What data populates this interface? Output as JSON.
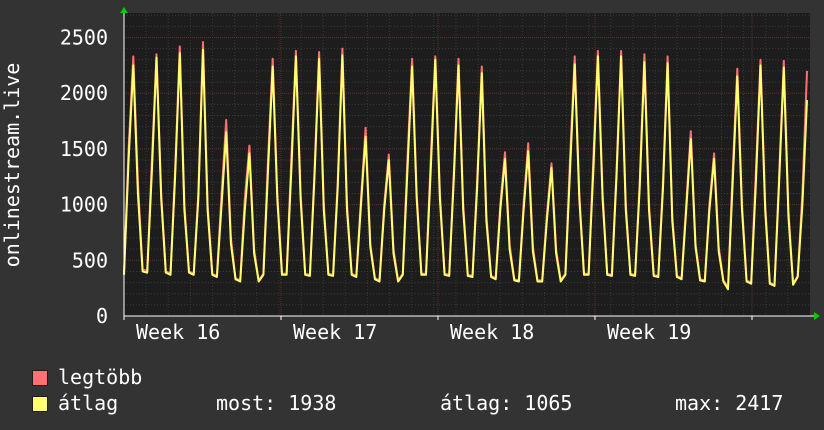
{
  "chart_data": {
    "type": "line",
    "ylabel": "onlinestream.live",
    "y_ticks": [
      0,
      500,
      1000,
      1500,
      2000,
      2500
    ],
    "ylim": [
      0,
      2500
    ],
    "x_ticks": [
      "Week 16",
      "Week 17",
      "Week 18",
      "Week 19"
    ],
    "grid": true,
    "series": [
      {
        "name": "legtöbb",
        "color": "#ff7070",
        "daily_peaks": [
          2330,
          2350,
          2420,
          2460,
          1760,
          1530,
          2310,
          2380,
          2370,
          2400,
          1690,
          1450,
          2310,
          2330,
          2310,
          2240,
          1470,
          1550,
          1370,
          2330,
          2380,
          2380,
          2350,
          2330,
          1660,
          1460,
          2220,
          2300,
          2290,
          2200
        ],
        "values": [
          380,
          1500,
          2330,
          1200,
          420,
          400,
          1400,
          2350,
          1100,
          400,
          380,
          1300,
          2420,
          1000,
          400,
          380,
          1100,
          2460,
          1000,
          380,
          360,
          1100,
          1760,
          700,
          340,
          320,
          1050,
          1530,
          600,
          320,
          380,
          1400,
          2310,
          1100,
          380,
          380,
          1400,
          2380,
          1100,
          380,
          370,
          1300,
          2370,
          1000,
          380,
          370,
          1200,
          2400,
          1000,
          380,
          360,
          1050,
          1690,
          650,
          340,
          320,
          1000,
          1450,
          600,
          320,
          380,
          1400,
          2310,
          1100,
          380,
          380,
          1400,
          2330,
          1100,
          380,
          370,
          1300,
          2310,
          1000,
          370,
          360,
          1200,
          2240,
          900,
          360,
          340,
          1000,
          1470,
          640,
          330,
          320,
          1000,
          1550,
          620,
          320,
          320,
          900,
          1370,
          600,
          320,
          380,
          1400,
          2330,
          1100,
          380,
          380,
          1400,
          2380,
          1100,
          380,
          370,
          1300,
          2380,
          1000,
          380,
          370,
          1200,
          2350,
          1000,
          370,
          360,
          1200,
          2330,
          900,
          360,
          340,
          1000,
          1660,
          650,
          330,
          320,
          1000,
          1460,
          620,
          320,
          260,
          1300,
          2220,
          1000,
          320,
          300,
          1300,
          2300,
          1000,
          300,
          280,
          1250,
          2290,
          950,
          290,
          360,
          1100,
          2200
        ]
      },
      {
        "name": "átlag",
        "color": "#ffff70",
        "daily_peaks": [
          2250,
          2320,
          2360,
          2390,
          1650,
          1460,
          2240,
          2330,
          2310,
          2340,
          1610,
          1400,
          2240,
          2300,
          2250,
          2180,
          1410,
          1480,
          1330,
          2260,
          2330,
          2330,
          2280,
          2270,
          1590,
          1410,
          2150,
          2250,
          2230,
          1938
        ],
        "values": [
          370,
          1400,
          2250,
          1100,
          400,
          390,
          1300,
          2320,
          1050,
          390,
          370,
          1250,
          2360,
          950,
          390,
          370,
          1050,
          2390,
          950,
          370,
          350,
          1000,
          1650,
          650,
          330,
          310,
          950,
          1460,
          560,
          310,
          370,
          1300,
          2240,
          1050,
          370,
          370,
          1300,
          2330,
          1050,
          370,
          360,
          1250,
          2310,
          950,
          370,
          360,
          1150,
          2340,
          950,
          370,
          350,
          1000,
          1610,
          620,
          330,
          310,
          950,
          1400,
          560,
          310,
          370,
          1300,
          2240,
          1050,
          370,
          370,
          1300,
          2300,
          1050,
          370,
          360,
          1250,
          2250,
          950,
          360,
          350,
          1150,
          2180,
          850,
          350,
          330,
          950,
          1410,
          600,
          320,
          310,
          950,
          1480,
          580,
          310,
          310,
          850,
          1330,
          560,
          310,
          370,
          1300,
          2260,
          1050,
          370,
          370,
          1300,
          2330,
          1050,
          370,
          360,
          1250,
          2330,
          950,
          370,
          360,
          1150,
          2280,
          950,
          360,
          350,
          1150,
          2270,
          850,
          350,
          330,
          950,
          1590,
          620,
          320,
          310,
          950,
          1410,
          580,
          310,
          240,
          1200,
          2150,
          950,
          310,
          290,
          1200,
          2250,
          950,
          290,
          270,
          1200,
          2230,
          900,
          280,
          350,
          1000,
          1938
        ]
      }
    ]
  },
  "legend": {
    "max_label": "legtöbb",
    "avg_label": "átlag",
    "now_text": "most: 1938",
    "avg_text": "átlag: 1065",
    "max_text": "max: 2417"
  }
}
